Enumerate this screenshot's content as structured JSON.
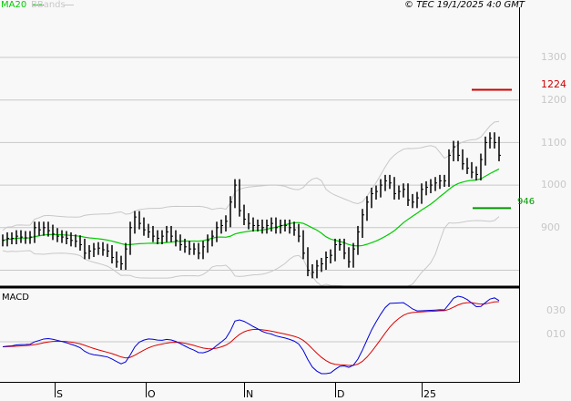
{
  "legend": {
    "ma_label": "MA20",
    "bb_label": "BBands"
  },
  "copyright": "© TEC 19/1/2025 4:0 GMT",
  "colors": {
    "ma": "#00cc00",
    "bb": "#c8c8c8",
    "macd": "#0000dd",
    "signal": "#dd0000",
    "resistance": "#cc0000",
    "support": "#009900"
  },
  "macd_panel": {
    "title": "MACD",
    "ticks": [
      "030",
      "010"
    ]
  },
  "chart_data": {
    "type": "ohlc",
    "title": "",
    "ylim": [
      770,
      1340
    ],
    "yticks": [
      1300,
      1200,
      1100,
      1000,
      900
    ],
    "ytick_labels": [
      "1300",
      "1200",
      "1100",
      "1000",
      "900"
    ],
    "xtick_labels": [
      "S",
      "O",
      "N",
      "D",
      "25"
    ],
    "resistance": {
      "value": 1224,
      "label": "1224"
    },
    "support": {
      "value": 946,
      "label": "946"
    },
    "closes": [
      870,
      875,
      875,
      880,
      878,
      876,
      878,
      900,
      895,
      900,
      893,
      885,
      880,
      878,
      875,
      870,
      868,
      860,
      840,
      845,
      850,
      852,
      848,
      845,
      830,
      820,
      815,
      850,
      900,
      925,
      910,
      895,
      890,
      880,
      875,
      880,
      890,
      880,
      870,
      860,
      855,
      850,
      850,
      840,
      855,
      870,
      880,
      900,
      905,
      915,
      960,
      1000,
      940,
      920,
      910,
      905,
      905,
      900,
      905,
      910,
      900,
      905,
      905,
      900,
      895,
      880,
      840,
      800,
      795,
      810,
      815,
      830,
      835,
      860,
      860,
      840,
      820,
      850,
      890,
      930,
      960,
      980,
      985,
      1000,
      1010,
      1005,
      980,
      985,
      990,
      965,
      960,
      970,
      990,
      995,
      1000,
      1005,
      1010,
      1010,
      1070,
      1090,
      1070,
      1050,
      1040,
      1030,
      1025,
      1060,
      1100,
      1110,
      1100,
      1070
    ]
  }
}
